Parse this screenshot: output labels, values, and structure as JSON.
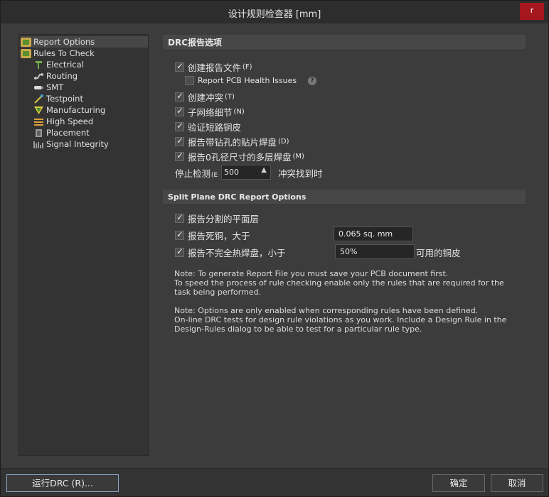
{
  "window": {
    "title": "设计规则检查器 [mm]",
    "close_label": "r"
  },
  "tree": {
    "items": [
      {
        "label": "Report Options",
        "icon": "report-options-icon"
      },
      {
        "label": "Rules To Check",
        "icon": "rules-folder-icon"
      },
      {
        "label": "Electrical",
        "icon": "electrical-icon"
      },
      {
        "label": "Routing",
        "icon": "routing-icon"
      },
      {
        "label": "SMT",
        "icon": "smt-icon"
      },
      {
        "label": "Testpoint",
        "icon": "testpoint-icon"
      },
      {
        "label": "Manufacturing",
        "icon": "manufacturing-icon"
      },
      {
        "label": "High Speed",
        "icon": "high-speed-icon"
      },
      {
        "label": "Placement",
        "icon": "placement-icon"
      },
      {
        "label": "Signal Integrity",
        "icon": "signal-integrity-icon"
      }
    ]
  },
  "drc_options": {
    "header": "DRC报告选项",
    "create_report": {
      "label": "创建报告文件",
      "shortcut": "(F)",
      "checked": true
    },
    "report_pcb_health": {
      "label": "Report PCB Health Issues",
      "checked": false
    },
    "create_violations": {
      "label": "创建冲突",
      "shortcut": "(T)",
      "checked": true
    },
    "subnet_details": {
      "label": "子网络细节",
      "shortcut": "(N)",
      "checked": true
    },
    "verify_shorting": {
      "label": "验证短路铜皮",
      "checked": true
    },
    "report_drilled_smt": {
      "label": "报告带钻孔的贴片焊盘",
      "shortcut": "(D)",
      "checked": true
    },
    "report_zero_hole": {
      "label": "报告0孔径尺寸的多层焊盘",
      "shortcut": "(M)",
      "checked": true
    },
    "stop_when": {
      "label": "停止检测",
      "shortcut": "(E",
      "value": "500",
      "suffix": "冲突找到时"
    }
  },
  "split_plane": {
    "header": "Split Plane DRC Report Options",
    "report_split": {
      "label": "报告分割的平面层",
      "checked": true
    },
    "report_dead_copper": {
      "label": "报告死铜，大于",
      "value": "0.065 sq. mm",
      "checked": true
    },
    "report_incomplete": {
      "label": "报告不完全热焊盘，小于",
      "value": "50%",
      "suffix": "可用的铜皮",
      "checked": true
    }
  },
  "note": {
    "line1": "Note: To generate Report File you must save your PCB document first.",
    "line2": "To speed the process of rule checking enable only the rules that are required for the task being performed.",
    "line3": "Note: Options are only enabled when corresponding rules have been defined.",
    "line4": "On-line DRC tests for design rule violations as you work. Include a Design Rule in the Design-Rules dialog to be able to test for a particular rule  type."
  },
  "footer": {
    "run_drc": "运行DRC (R)...",
    "ok": "确定",
    "cancel": "取消"
  }
}
